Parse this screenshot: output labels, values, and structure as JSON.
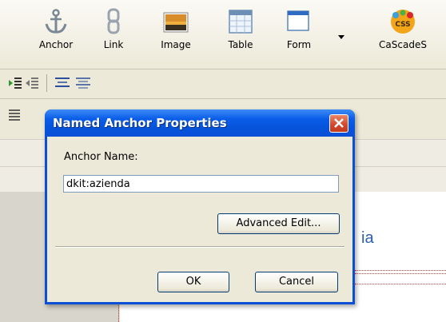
{
  "toolbar": {
    "buttons": [
      {
        "label": "Anchor",
        "icon": "anchor-icon"
      },
      {
        "label": "Link",
        "icon": "link-icon"
      },
      {
        "label": "Image",
        "icon": "image-icon"
      },
      {
        "label": "Table",
        "icon": "table-icon"
      },
      {
        "label": "Form",
        "icon": "form-icon"
      },
      {
        "label": "CaScadeS",
        "icon": "css-icon",
        "icon_text": "CSS"
      }
    ]
  },
  "page": {
    "visible_text": "ia"
  },
  "dialog": {
    "title": "Named Anchor Properties",
    "anchor_label": "Anchor Name:",
    "anchor_value": "dkit:azienda",
    "advanced_label": "Advanced Edit...",
    "ok_label": "OK",
    "cancel_label": "Cancel"
  },
  "colors": {
    "titlebar": "#0a4fd6",
    "close_button": "#d4452a",
    "dialog_body": "#ece9d8",
    "page_heading": "#2a5fae"
  }
}
